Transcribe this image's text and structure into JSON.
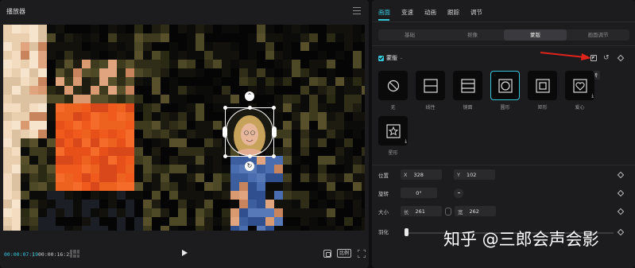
{
  "player": {
    "title": "播放器",
    "time_current": "00:00:07:19",
    "time_total": "00:00:16:22",
    "ratio_label": "比例"
  },
  "props": {
    "tabs": [
      "画面",
      "变速",
      "动画",
      "跟踪",
      "调节"
    ],
    "subtabs": [
      "基础",
      "抠像",
      "蒙版",
      "画面调节"
    ],
    "mask_label": "蒙版",
    "tooltip": "反转",
    "shapes": [
      {
        "label": "无",
        "icon": "none-icon"
      },
      {
        "label": "线性",
        "icon": "linear-icon"
      },
      {
        "label": "镜面",
        "icon": "mirror-icon"
      },
      {
        "label": "圆形",
        "icon": "circle-icon"
      },
      {
        "label": "矩形",
        "icon": "rectangle-icon"
      },
      {
        "label": "爱心",
        "icon": "heart-icon"
      },
      {
        "label": "星形",
        "icon": "star-icon"
      }
    ],
    "position": {
      "label": "位置",
      "x_key": "X",
      "x": "328",
      "y_key": "Y",
      "y": "102"
    },
    "rotation": {
      "label": "旋转",
      "value": "0°"
    },
    "size": {
      "label": "大小",
      "w_key": "长",
      "w": "261",
      "h_key": "宽",
      "h": "262"
    },
    "feather": {
      "label": "羽化",
      "value": 0
    }
  },
  "watermark": "知乎 @三郎会声会影",
  "colors": {
    "accent": "#36c6d8",
    "arrow": "#e0241b"
  }
}
